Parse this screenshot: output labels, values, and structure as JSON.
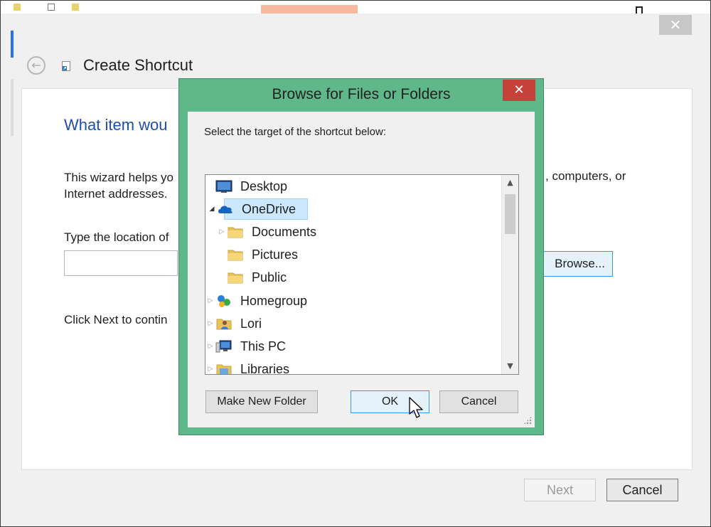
{
  "wizard": {
    "title": "Create Shortcut",
    "close_glyph": "✕",
    "back_glyph": "←",
    "question": "What item wou",
    "intro_left": "This wizard helps yo Internet addresses.",
    "intro_right": ", computers, or",
    "location_label": "Type the location of",
    "location_value": "",
    "browse_label": "Browse...",
    "next_hint": "Click Next to contin",
    "next_label": "Next",
    "cancel_label": "Cancel"
  },
  "dialog": {
    "title": "Browse for Files or Folders",
    "close_glyph": "✕",
    "prompt": "Select the target of the shortcut below:",
    "tree": [
      {
        "label": "Desktop",
        "icon": "desktop-icon",
        "expander": ""
      },
      {
        "label": "OneDrive",
        "icon": "onedrive-icon",
        "expander": "◢"
      },
      {
        "label": "Documents",
        "icon": "folder-icon",
        "expander": "▷"
      },
      {
        "label": "Pictures",
        "icon": "folder-icon",
        "expander": ""
      },
      {
        "label": "Public",
        "icon": "folder-icon",
        "expander": ""
      },
      {
        "label": "Homegroup",
        "icon": "homegroup-icon",
        "expander": "▷"
      },
      {
        "label": "Lori",
        "icon": "user-folder-icon",
        "expander": "▷"
      },
      {
        "label": "This PC",
        "icon": "computer-icon",
        "expander": "▷"
      },
      {
        "label": "Libraries",
        "icon": "libraries-icon",
        "expander": "▷"
      }
    ],
    "selected": "OneDrive",
    "make_new_folder_label": "Make New Folder",
    "ok_label": "OK",
    "cancel_label": "Cancel"
  },
  "colors": {
    "dialog_border": "#5fb88a",
    "close_red": "#c7413b",
    "heading_blue": "#1f4fa3",
    "selection": "#cce8ff"
  }
}
